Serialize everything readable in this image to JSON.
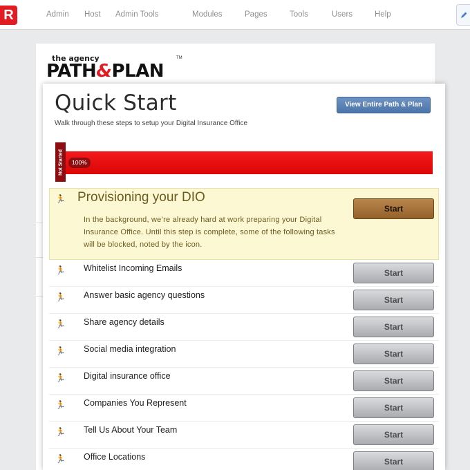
{
  "nav": {
    "brand_letter": "R",
    "items": [
      {
        "label": "Admin"
      },
      {
        "label": "Host"
      },
      {
        "label": "Admin Tools"
      },
      {
        "label": "Modules"
      },
      {
        "label": "Pages"
      },
      {
        "label": "Tools"
      },
      {
        "label": "Users"
      },
      {
        "label": "Help"
      }
    ],
    "edit_icon": "pencil-icon"
  },
  "logo": {
    "line1": "the agency",
    "path": "PATH",
    "amp": "&",
    "plan": "PLAN",
    "tm": "TM"
  },
  "quick_start": {
    "title": "Quick Start",
    "subtitle": "Walk through these steps to setup your Digital Insurance Office",
    "view_button": "View Entire Path & Plan",
    "status_flag": "Not Started",
    "progress": {
      "percent": 100,
      "label": "100%",
      "color": "#e80f0f"
    },
    "highlight_step": {
      "title": "Provisioning your DIO",
      "description": "In the background, we’re already hard at work preparing your Digital Insurance Office. Until this step is complete, some of the following tasks will be blocked, noted by the icon.",
      "button": "Start",
      "icon": "runner-icon"
    },
    "steps": [
      {
        "label": "Whitelist Incoming Emails",
        "button": "Start"
      },
      {
        "label": "Answer basic agency questions",
        "button": "Start"
      },
      {
        "label": "Share agency details",
        "button": "Start"
      },
      {
        "label": "Social media integration",
        "button": "Start"
      },
      {
        "label": "Digital insurance office",
        "button": "Start"
      },
      {
        "label": "Companies You Represent",
        "button": "Start"
      },
      {
        "label": "Tell Us About Your Team",
        "button": "Start"
      },
      {
        "label": "Office Locations",
        "button": "Start"
      }
    ]
  },
  "colors": {
    "brand": "#e31b23",
    "accent_blue": "#4c74aa",
    "highlight_bg": "#fcf8d3",
    "primary_button": "#94612a"
  }
}
